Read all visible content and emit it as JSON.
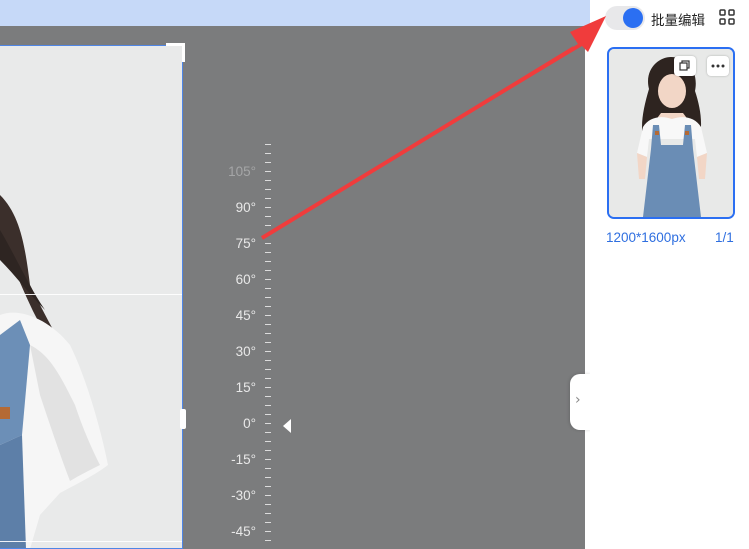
{
  "canvas": {
    "ruler": {
      "labels": [
        {
          "text": "105°",
          "dim": true
        },
        {
          "text": "90°",
          "dim": false
        },
        {
          "text": "75°",
          "dim": false
        },
        {
          "text": "60°",
          "dim": false
        },
        {
          "text": "45°",
          "dim": false
        },
        {
          "text": "30°",
          "dim": false
        },
        {
          "text": "15°",
          "dim": false
        },
        {
          "text": "0°",
          "dim": false
        },
        {
          "text": "-15°",
          "dim": false
        },
        {
          "text": "-30°",
          "dim": false
        },
        {
          "text": "-45°",
          "dim": false
        }
      ],
      "current_angle": "0°"
    }
  },
  "panel": {
    "batch_edit_label": "批量编辑",
    "batch_edit_enabled": true,
    "thumbnail": {
      "size_text": "1200*1600px",
      "page_text": "1/1"
    }
  },
  "colors": {
    "accent": "#2b6ff2",
    "canvas_bg": "#7b7c7d",
    "annotation_arrow": "#f03c3c"
  },
  "icons": [
    "grid-view-icon",
    "duplicate-icon",
    "more-icon",
    "chevron-right-icon",
    "angle-pointer-icon"
  ]
}
